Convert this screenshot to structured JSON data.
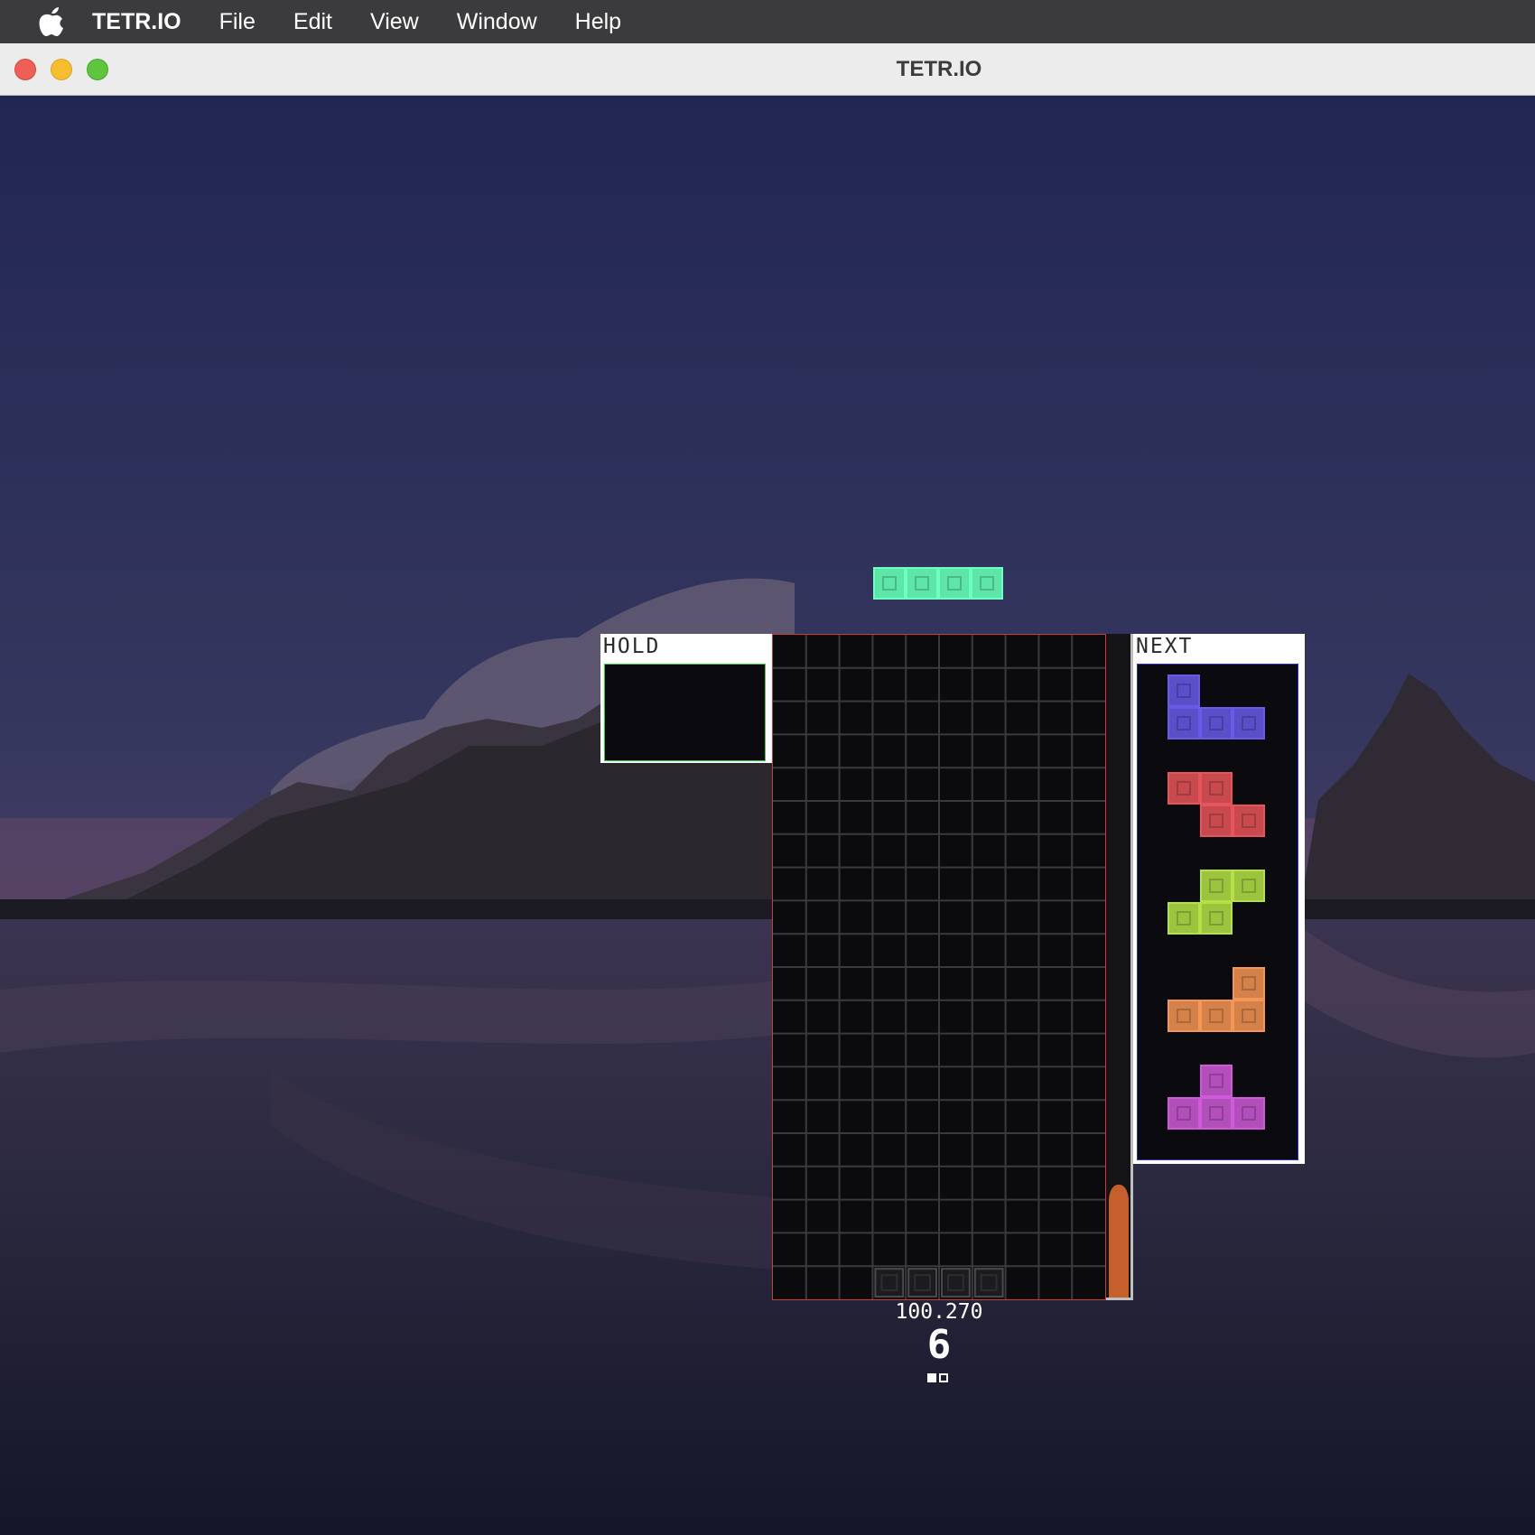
{
  "menubar": {
    "app_name": "TETR.IO",
    "items": [
      "File",
      "Edit",
      "View",
      "Window",
      "Help"
    ]
  },
  "window": {
    "title": "TETR.IO"
  },
  "game": {
    "hold": {
      "label": "HOLD",
      "piece": null
    },
    "next": {
      "label": "NEXT",
      "queue": [
        {
          "piece": "J",
          "color": "#5b4fc9"
        },
        {
          "piece": "Z",
          "color": "#c84a4f"
        },
        {
          "piece": "S",
          "color": "#9dc43e"
        },
        {
          "piece": "L",
          "color": "#d4824a"
        },
        {
          "piece": "T",
          "color": "#b24fbb"
        }
      ]
    },
    "active_piece": {
      "piece": "I",
      "color": "#5ee6a8"
    },
    "board": {
      "columns": 10,
      "rows": 20
    },
    "garbage_meter": {
      "level": 0.17,
      "color": "#c5602c"
    },
    "stats": {
      "time": "100.270",
      "lines": "6",
      "indicator": [
        true,
        false
      ]
    }
  },
  "colors": {
    "board_border": "#ce3b3b",
    "hold_border": "#2fd13c",
    "next_border": "#2430d6"
  }
}
